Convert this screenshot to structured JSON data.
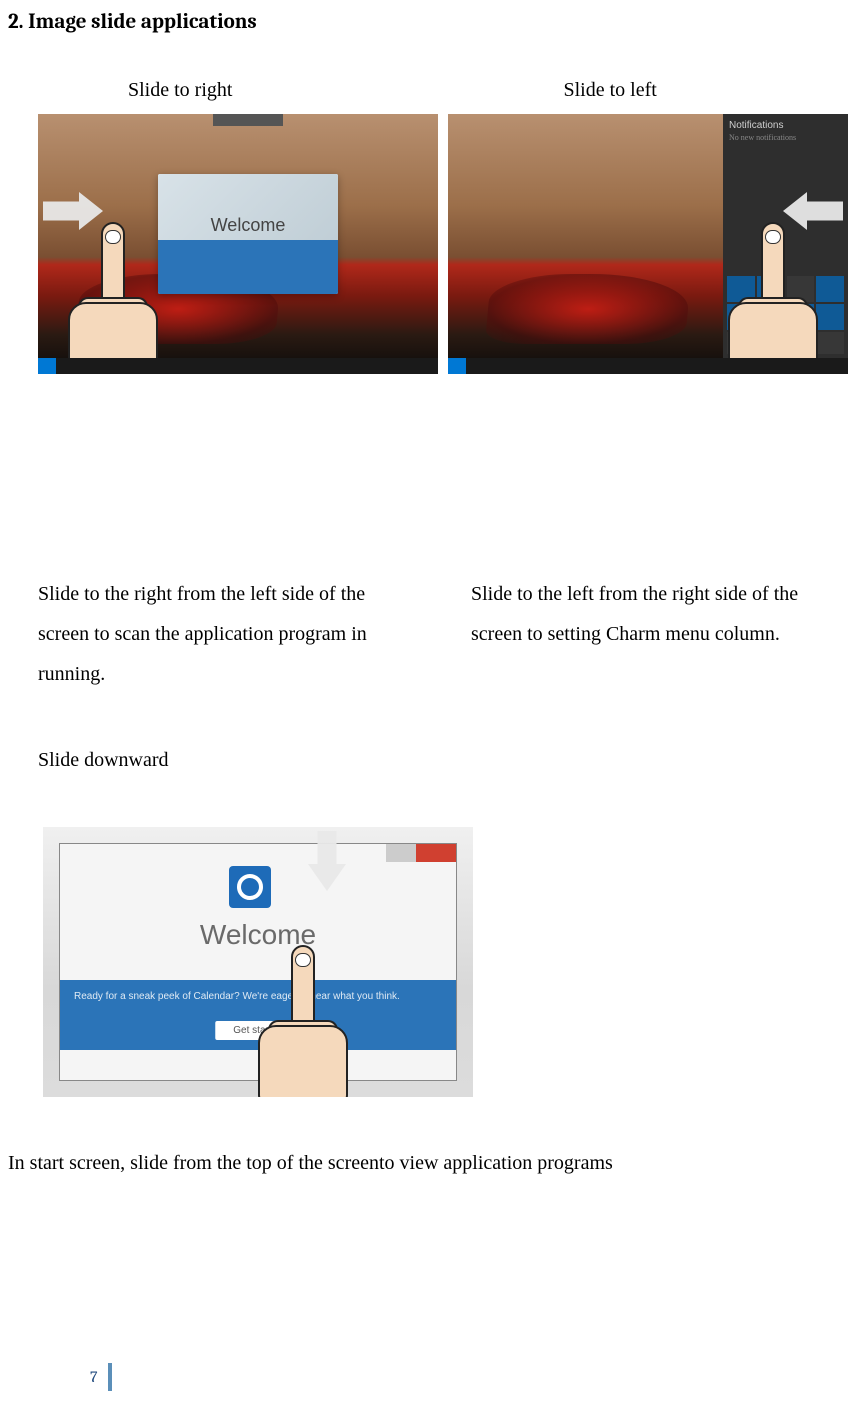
{
  "heading": "2. Image slide applications",
  "captions": {
    "slide_right": "Slide to right",
    "slide_left": "Slide to left",
    "slide_down": "Slide downward"
  },
  "descriptions": {
    "right_desc": "Slide to the right from the left side of the screen to scan the application program in running.",
    "left_desc": "Slide to the left from the right side of the screen to setting Charm menu column.",
    "down_desc": "In start screen, slide from the top of the screento view application programs"
  },
  "screenshots": {
    "welcome_card_title": "Welcome",
    "notif_title": "Notifications",
    "notif_sub": "No new notifications",
    "outlook_welcome": "Welcome",
    "banner_blurb": "Ready for a sneak peek of Calendar? We're eager to hear what you think.",
    "get_started": "Get started"
  },
  "page_number": "7"
}
